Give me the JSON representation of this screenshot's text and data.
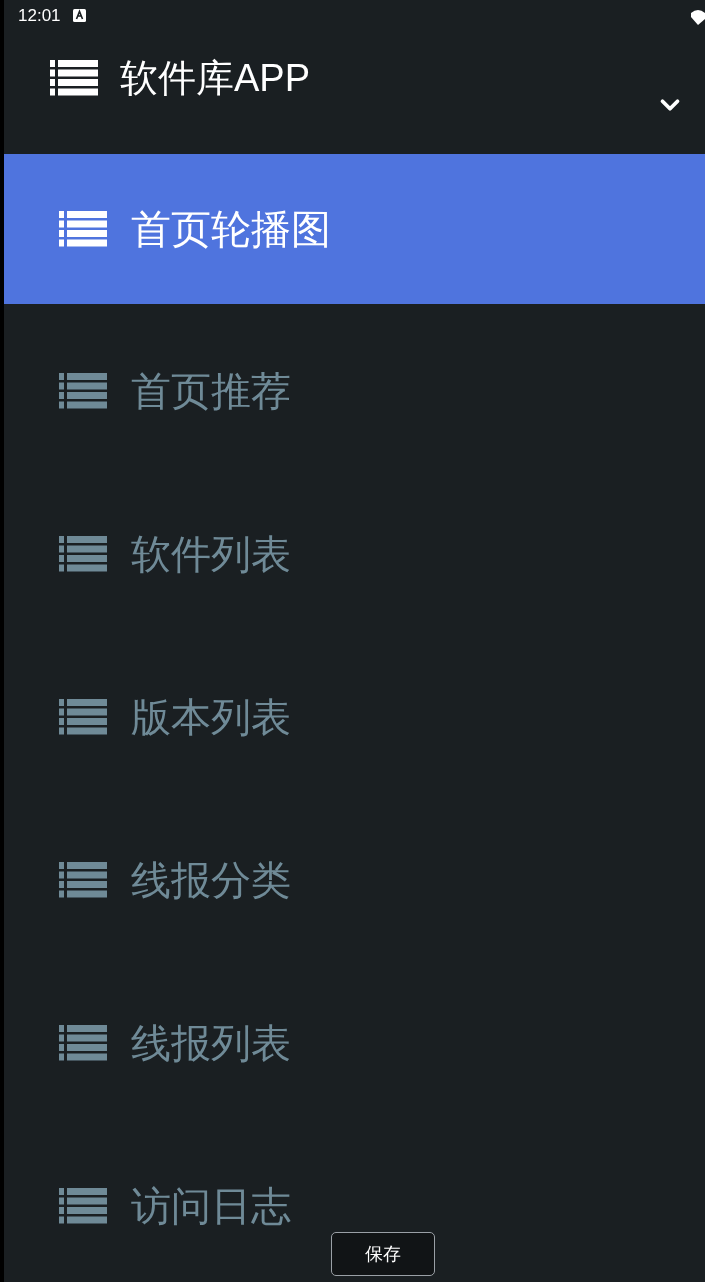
{
  "status_bar": {
    "time": "12:01"
  },
  "header": {
    "title": "软件库APP",
    "expanded": true
  },
  "menu": [
    {
      "label": "首页轮播图",
      "selected": true
    },
    {
      "label": "首页推荐",
      "selected": false
    },
    {
      "label": "软件列表",
      "selected": false
    },
    {
      "label": "版本列表",
      "selected": false
    },
    {
      "label": "线报分类",
      "selected": false
    },
    {
      "label": "线报列表",
      "selected": false
    },
    {
      "label": "访问日志",
      "selected": false
    }
  ],
  "save_button": {
    "label": "保存"
  }
}
